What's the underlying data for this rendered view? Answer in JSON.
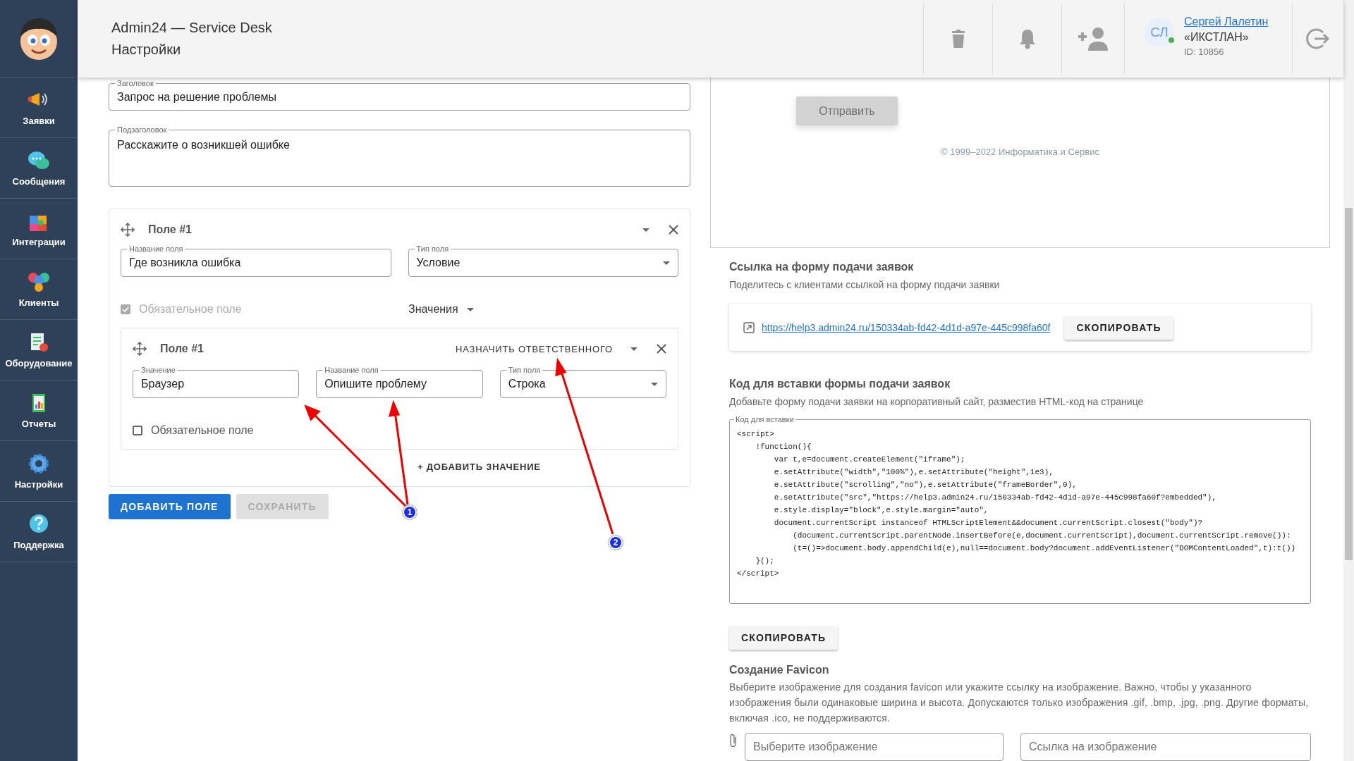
{
  "app": {
    "title": "Admin24 — Service Desk",
    "page": "Настройки"
  },
  "sidebar": {
    "items": [
      {
        "label": "Заявки",
        "kind": "megaphone"
      },
      {
        "label": "Сообщения",
        "kind": "chat"
      },
      {
        "label": "Интеграции",
        "kind": "puzzle"
      },
      {
        "label": "Клиенты",
        "kind": "people"
      },
      {
        "label": "Оборудование",
        "kind": "checklist"
      },
      {
        "label": "Отчеты",
        "kind": "report"
      },
      {
        "label": "Настройки",
        "kind": "gear"
      },
      {
        "label": "Поддержка",
        "kind": "help"
      }
    ]
  },
  "user": {
    "initials": "СЛ",
    "name": "Сергей Лалетин",
    "company": "«ИКСТЛАН»",
    "id": "ID: 10856",
    "online": true
  },
  "form": {
    "title_field": {
      "label": "Заголовок",
      "value": "Запрос на решение проблемы"
    },
    "subtitle_field": {
      "label": "Подзаголовок",
      "value": "Расскажите о возникшей ошибке"
    },
    "field_card": {
      "title": "Поле #1",
      "name_field": {
        "label": "Название поля",
        "value": "Где возникла ошибка"
      },
      "type_field": {
        "label": "Тип поля",
        "value": "Условие"
      },
      "required": {
        "label": "Обязательное поле",
        "checked": true,
        "disabled": true
      },
      "values_menu": "Значения",
      "value_card": {
        "title": "Поле #1",
        "assign_button": "НАЗНАЧИТЬ ОТВЕТСТВЕННОГО",
        "value_field": {
          "label": "Значение",
          "value": "Браузер"
        },
        "name_field": {
          "label": "Название поля",
          "value": "Опишите проблему"
        },
        "type_field": {
          "label": "Тип поля",
          "value": "Строка"
        },
        "required": {
          "label": "Обязательное поле",
          "checked": false
        }
      },
      "add_value": "+ ДОБАВИТЬ ЗНАЧЕНИЕ"
    },
    "buttons": [
      {
        "label": "ДОБАВИТЬ ПОЛЕ",
        "disabled": false
      },
      {
        "label": "СОХРАНИТЬ",
        "disabled": true
      }
    ]
  },
  "preview": {
    "submit": "Отправить",
    "copyright": "© 1999–2022 Информатика и Сервис"
  },
  "link_section": {
    "title": "Ссылка на форму подачи заявок",
    "subtitle": "Поделитесь с клиентами ссылкой на форму подачи заявки",
    "url": "https://help3.admin24.ru/150334ab-fd42-4d1d-a97e-445c998fa60f",
    "copy": "СКОПИРОВАТЬ"
  },
  "embed_section": {
    "title": "Код для вставки формы подачи заявок",
    "subtitle": "Добавьте форму подачи заявки на корпоративный сайт, разместив HTML-код на странице",
    "code_label": "Код для вставки",
    "code": "<script>\n    !function(){\n        var t,e=document.createElement(\"iframe\");\n        e.setAttribute(\"width\",\"100%\"),e.setAttribute(\"height\",1e3),\n        e.setAttribute(\"scrolling\",\"no\"),e.setAttribute(\"frameBorder\",0),\n        e.setAttribute(\"src\",\"https://help3.admin24.ru/150334ab-fd42-4d1d-a97e-445c998fa60f?embedded\"),\n        e.style.display=\"block\",e.style.margin=\"auto\",\n        document.currentScript instanceof HTMLScriptElement&&document.currentScript.closest(\"body\")?\n            (document.currentScript.parentNode.insertBefore(e,document.currentScript),document.currentScript.remove()):\n            (t=()=>document.body.appendChild(e),null==document.body?document.addEventListener(\"DOMContentLoaded\",t):t())\n    }();\n</script>",
    "copy": "СКОПИРОВАТЬ"
  },
  "favicon_section": {
    "title": "Создание Favicon",
    "description": "Выберите изображение для создания favicon или укажите ссылку на изображение. Важно, чтобы у указанного изображения были одинаковые ширина и высота. Допускаются только изображения .gif, .bmp, .jpg, .png. Другие форматы, включая .ico, не поддерживаются.",
    "file_placeholder": "Выберите изображение",
    "url_placeholder": "Ссылка на изображение"
  },
  "annotations": [
    {
      "number": "1"
    },
    {
      "number": "2"
    }
  ]
}
